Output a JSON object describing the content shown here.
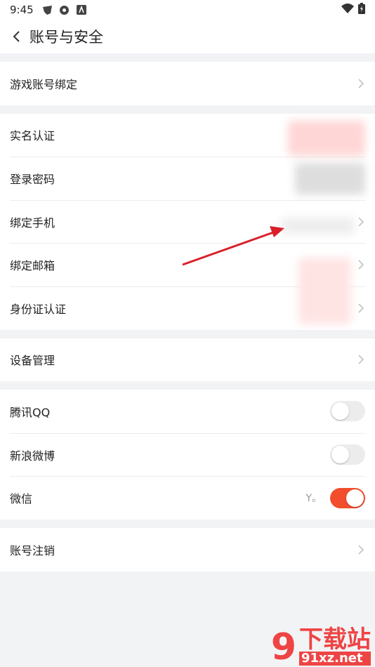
{
  "status_bar": {
    "time": "9:45",
    "icons": [
      "app-notification-icon",
      "app-notification-icon",
      "app-notification-icon"
    ],
    "battery_indicator": "battery-charging-icon",
    "wifi": "wifi-icon"
  },
  "header": {
    "title": "账号与安全"
  },
  "sections": {
    "game": {
      "items": [
        {
          "label": "游戏账号绑定"
        }
      ]
    },
    "identity": {
      "items": [
        {
          "label": "实名认证"
        },
        {
          "label": "登录密码"
        },
        {
          "label": "绑定手机"
        },
        {
          "label": "绑定邮箱"
        },
        {
          "label": "身份证认证"
        }
      ]
    },
    "device": {
      "items": [
        {
          "label": "设备管理"
        }
      ]
    },
    "social": {
      "items": [
        {
          "label": "腾讯QQ",
          "on": false
        },
        {
          "label": "新浪微博",
          "on": false
        },
        {
          "label": "微信",
          "value": "Y。",
          "on": true
        }
      ]
    },
    "cancel": {
      "items": [
        {
          "label": "账号注销"
        }
      ]
    }
  },
  "colors": {
    "accent": "#f24d2c",
    "background": "#f2f3f5",
    "arrow": "#d9202a"
  },
  "watermark": {
    "number": "9",
    "cn": "下载站",
    "en": "91xz.net"
  }
}
